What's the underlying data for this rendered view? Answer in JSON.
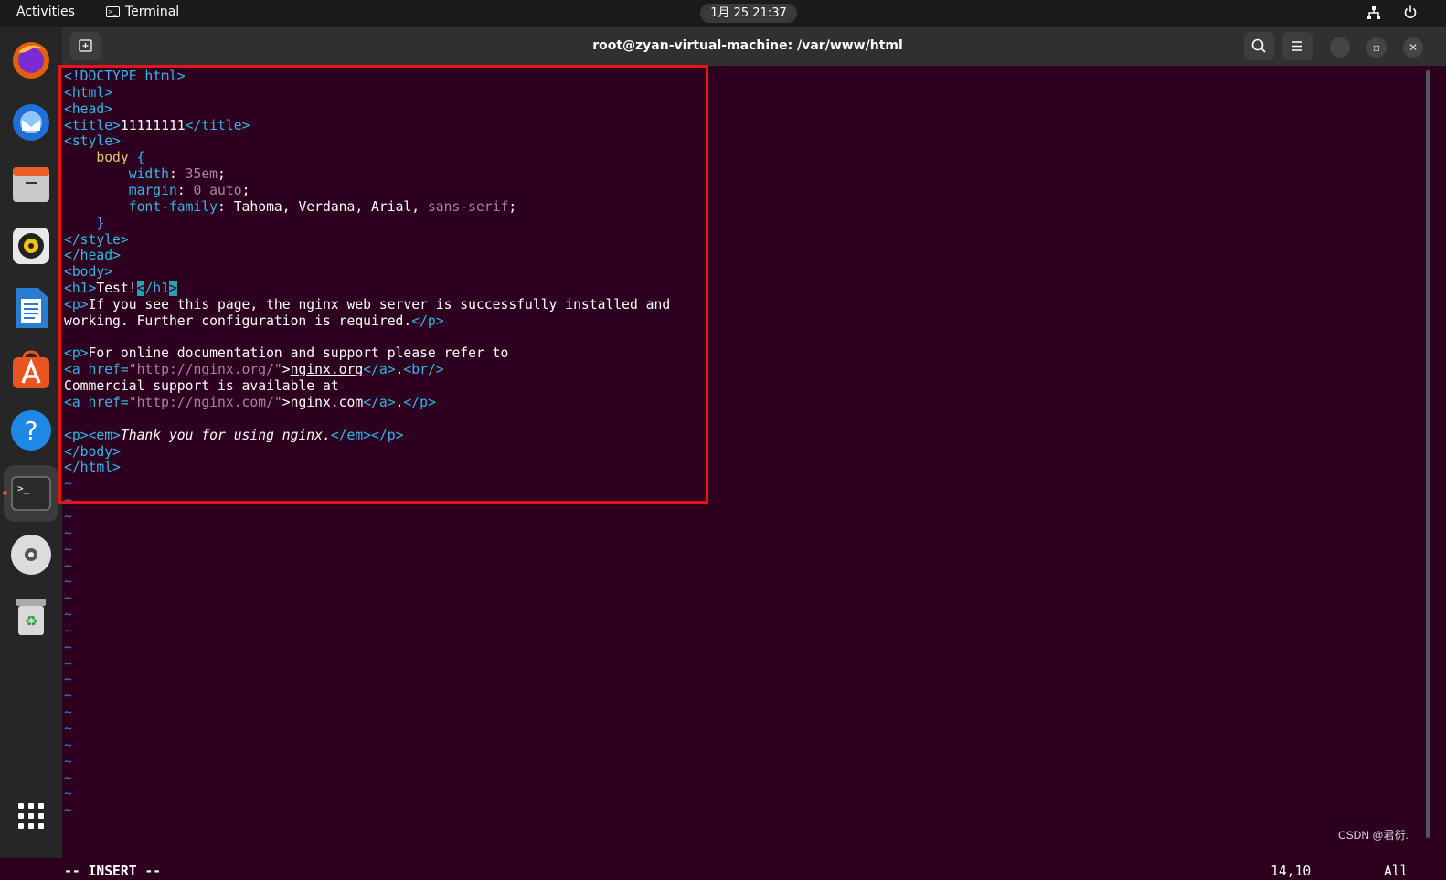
{
  "topbar": {
    "activities": "Activities",
    "app_name": "Terminal",
    "clock": "1月 25  21:37",
    "network_icon": "network-wired-icon",
    "power_icon": "power-icon"
  },
  "dock": {
    "items": [
      {
        "name": "Firefox",
        "icon": "firefox-icon"
      },
      {
        "name": "Thunderbird",
        "icon": "thunderbird-icon"
      },
      {
        "name": "Files",
        "icon": "files-icon"
      },
      {
        "name": "Rhythmbox",
        "icon": "rhythmbox-icon"
      },
      {
        "name": "LibreOffice Writer",
        "icon": "writer-icon"
      },
      {
        "name": "Ubuntu Software",
        "icon": "software-icon"
      },
      {
        "name": "Help",
        "icon": "help-icon"
      },
      {
        "name": "Terminal",
        "icon": "terminal-icon",
        "active": true
      },
      {
        "name": "DVD",
        "icon": "dvd-icon"
      },
      {
        "name": "Trash",
        "icon": "trash-icon"
      }
    ],
    "apps_grid_icon": "show-apps-icon"
  },
  "window": {
    "title": "root@zyan-virtual-machine: /var/www/html",
    "buttons": {
      "new_tab": "new-tab-icon",
      "search": "search-icon",
      "menu": "hamburger-menu-icon",
      "minimize": "–",
      "maximize": "▫",
      "close": "✕"
    }
  },
  "editor": {
    "lines": [
      "<!DOCTYPE html>",
      "<html>",
      "<head>",
      "<title>11111111</title>",
      "<style>",
      "    body {",
      "        width: 35em;",
      "        margin: 0 auto;",
      "        font-family: Tahoma, Verdana, Arial, sans-serif;",
      "    }",
      "</style>",
      "</head>",
      "<body>",
      "<h1>Test!</h1>",
      "<p>If you see this page, the nginx web server is successfully installed and",
      "working. Further configuration is required.</p>",
      "",
      "<p>For online documentation and support please refer to",
      "<a href=\"http://nginx.org/\">nginx.org</a>.<br/>",
      "Commercial support is available at",
      "<a href=\"http://nginx.com/\">nginx.com</a>.</p>",
      "",
      "<p><em>Thank you for using nginx.</em></p>",
      "</body>",
      "</html>"
    ],
    "tilde_count": 21,
    "tilde": "~",
    "mode": "-- INSERT --",
    "cursor_pos": "14,10",
    "scroll_pos": "All"
  },
  "watermark": "CSDN @君衍.",
  "colors": {
    "terminal_bg": "#2c001e",
    "tag": "#34b6e8",
    "attr_value": "#ad7fa8",
    "highlight_box": "#e8141b"
  }
}
